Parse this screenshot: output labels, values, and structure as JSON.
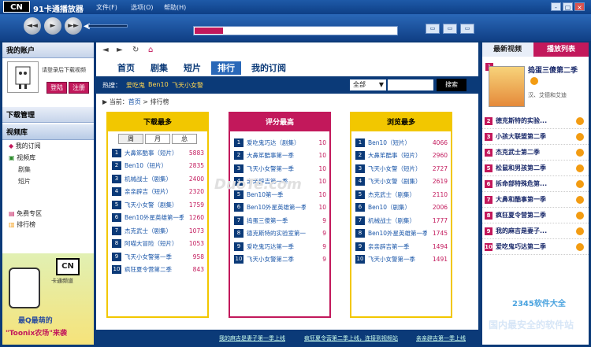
{
  "app": {
    "logo": "CN",
    "title": "91卡通播放器"
  },
  "menu": [
    "文件(F)",
    "选项(O)",
    "帮助(H)"
  ],
  "window_buttons": [
    "-",
    "▢",
    "×"
  ],
  "player": {
    "controls": [
      "◄◄",
      "►",
      "►►"
    ],
    "progress_pct": 14
  },
  "view_buttons": [
    "▭",
    "▭",
    "▭"
  ],
  "left": {
    "account_title": "我的账户",
    "login_hint": "请登录后下载视频",
    "login_btn": "登陆",
    "register_btn": "注册",
    "download_title": "下载管理",
    "library_title": "视频库",
    "nav": [
      {
        "label": "我的订阅"
      },
      {
        "label": "视频库"
      },
      {
        "label": "剧集",
        "sub": true
      },
      {
        "label": "短片",
        "sub": true
      },
      {
        "label": "免费专区"
      },
      {
        "label": "排行榜"
      }
    ],
    "promo_logo": "CN",
    "promo_logo_sub": "卡通频道",
    "promo_line1": "最Q最萌的",
    "promo_line2": "\"Toonix农场\"来袭"
  },
  "center": {
    "tabs": [
      "首页",
      "剧集",
      "短片",
      "排行",
      "我的订阅"
    ],
    "hot_label": "热搜：",
    "hot_items": [
      "爱吃鬼",
      "Ben10",
      "飞天小女警"
    ],
    "search_select": "全部",
    "search_button": "搜索",
    "breadcrumb": {
      "prefix": "当前：",
      "home": "首页",
      "sep": ">",
      "current": "排行榜"
    },
    "panels": [
      {
        "title": "下载最多",
        "subtabs": [
          "周",
          "月",
          "总"
        ],
        "rows": [
          {
            "name": "大鼻笫酷事（短片）",
            "value": "5883"
          },
          {
            "name": "Ben10（短片）",
            "value": "2835"
          },
          {
            "name": "机械战士（剧集）",
            "value": "2400"
          },
          {
            "name": "亲亲辟吉（短片）",
            "value": "2320"
          },
          {
            "name": "飞天小女警（剧集）",
            "value": "1759"
          },
          {
            "name": "Ben10外星英雄第一季",
            "value": "1260"
          },
          {
            "name": "杰克武士（剧集）",
            "value": "1073"
          },
          {
            "name": "阿喵大冒险（短片）",
            "value": "1053"
          },
          {
            "name": "飞天小女警第一季",
            "value": "958"
          },
          {
            "name": "疯狂夏令营第二季",
            "value": "843"
          }
        ]
      },
      {
        "title": "评分最高",
        "rows": [
          {
            "name": "爱吃鬼巧达（剧集）",
            "value": "10"
          },
          {
            "name": "大鼻笫酷事第一季",
            "value": "10"
          },
          {
            "name": "飞天小女警第一季",
            "value": "10"
          },
          {
            "name": "亲亲辟吉第一季",
            "value": "10"
          },
          {
            "name": "Ben10第一季",
            "value": "10"
          },
          {
            "name": "Ben10外星英雄第一季",
            "value": "10"
          },
          {
            "name": "捣蛋三傻第一季",
            "value": "9"
          },
          {
            "name": "德克斯特的实验室第一",
            "value": "9"
          },
          {
            "name": "爱吃鬼巧达第一季",
            "value": "9"
          },
          {
            "name": "飞天小女警第二季",
            "value": "9"
          }
        ]
      },
      {
        "title": "浏览最多",
        "rows": [
          {
            "name": "Ben10（短片）",
            "value": "4066"
          },
          {
            "name": "大鼻笫酷事（短片）",
            "value": "2960"
          },
          {
            "name": "飞天小女警（短片）",
            "value": "2727"
          },
          {
            "name": "飞天小女警（剧集）",
            "value": "2619"
          },
          {
            "name": "杰克武士（剧集）",
            "value": "2110"
          },
          {
            "name": "Ben10（剧集）",
            "value": "2006"
          },
          {
            "name": "机械战士（剧集）",
            "value": "1777"
          },
          {
            "name": "Ben10外星英雄第一季",
            "value": "1745"
          },
          {
            "name": "亲亲辟吉第一季",
            "value": "1494"
          },
          {
            "name": "飞天小女警第一季",
            "value": "1491"
          }
        ]
      }
    ]
  },
  "right": {
    "tab_new": "最新视频",
    "tab_playlist": "播放列表",
    "featured_num": "1",
    "featured_title": "捣蛋三傻第二季",
    "featured_meta": "汉、艾德和艾迪",
    "list": [
      {
        "num": "2",
        "title": "德克斯特的实验..."
      },
      {
        "num": "3",
        "title": "小孩大联盟第二季"
      },
      {
        "num": "4",
        "title": "杰克武士第二季"
      },
      {
        "num": "5",
        "title": "松鼠和男孩第二季"
      },
      {
        "num": "6",
        "title": "拆命部特殊危第..."
      },
      {
        "num": "7",
        "title": "大鼻和酷事第一季"
      },
      {
        "num": "8",
        "title": "疯狂夏令营第二季"
      },
      {
        "num": "9",
        "title": "我的麻吉是妻子..."
      },
      {
        "num": "10",
        "title": "爱吃鬼巧达第二季"
      }
    ]
  },
  "status": [
    "我的麻吉是妻子第一季上线",
    "疯狂夏令营第二季上线，连接到视频站",
    "亲亲辟吉第一季上线"
  ],
  "watermark": {
    "line1": "2345软件大全",
    "line2": "国内最安全的软件站",
    "center": "DuoTe.com"
  }
}
